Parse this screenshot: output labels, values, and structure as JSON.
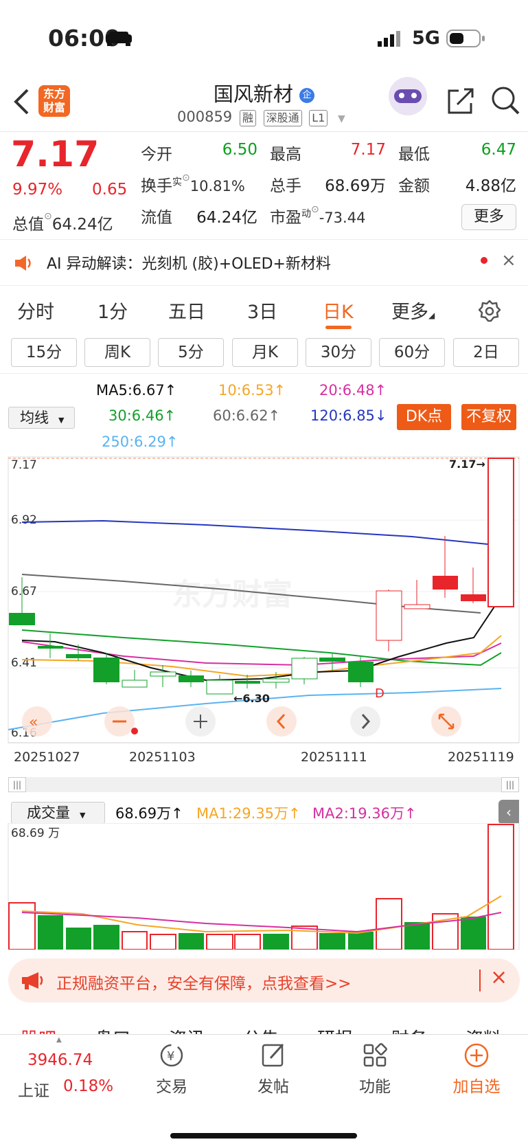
{
  "status_bar": {
    "time": "06:00",
    "network": "5G"
  },
  "header": {
    "logo_text_1": "东方",
    "logo_text_2": "财富",
    "stock_name": "国风新材",
    "stock_code": "000859",
    "tags": [
      "融",
      "深股通",
      "L1"
    ]
  },
  "quote": {
    "price": "7.17",
    "change_pct": "9.97%",
    "change_amt": "0.65",
    "open_label": "今开",
    "open": "6.50",
    "high_label": "最高",
    "high": "7.17",
    "low_label": "最低",
    "low": "6.47",
    "turnover_label": "换手",
    "turnover_sup": "实",
    "turnover": "10.81%",
    "volume_label": "总手",
    "volume": "68.69万",
    "amount_label": "金额",
    "amount": "4.88亿",
    "total_mv_label": "总值",
    "total_mv": "64.24亿",
    "float_mv_label": "流值",
    "float_mv": "64.24亿",
    "pe_label": "市盈",
    "pe_sup": "动",
    "pe": "-73.44",
    "more_button": "更多"
  },
  "ai_banner": {
    "text": "AI 异动解读：光刻机 (胶)+OLED+新材料"
  },
  "period_tabs": [
    "分时",
    "1分",
    "五日",
    "3日",
    "日K",
    "更多"
  ],
  "active_period": "日K",
  "sub_tabs": [
    "15分",
    "周K",
    "5分",
    "月K",
    "30分",
    "60分",
    "2日"
  ],
  "ma": {
    "selector": "均线",
    "ma5": "MA5:6.67↑",
    "ma10": "10:6.53↑",
    "ma20": "20:6.48↑",
    "ma30": "30:6.46↑",
    "ma60": "60:6.62↑",
    "ma120": "120:6.85↓",
    "ma250": "250:6.29↑",
    "dk_button": "DK点",
    "fq_button": "不复权",
    "colors": {
      "ma5": "#111111",
      "ma10": "#f5a623",
      "ma20": "#d62fa0",
      "ma30": "#12a02a",
      "ma60": "#666666",
      "ma120": "#2436c0",
      "ma250": "#5ab3f0"
    }
  },
  "kline": {
    "price_labels": [
      "7.17",
      "6.92",
      "6.67",
      "6.41",
      "6.16"
    ],
    "max_marker": "7.17→",
    "min_marker": "←6.30",
    "d_marker": "D",
    "watermark": "东方财富",
    "dates": [
      "20251027",
      "20251103",
      "20251111",
      "20251119"
    ]
  },
  "volume": {
    "selector": "成交量",
    "value": "68.69万↑",
    "ma1": "MA1:29.35万↑",
    "ma2": "MA2:19.36万↑",
    "axis_label": "68.69 万"
  },
  "promo": {
    "text": "正规融资平台，安全有保障，点我查看>>"
  },
  "info_tabs": [
    "股吧",
    "盘口",
    "资讯",
    "公告",
    "研报",
    "财务",
    "资料"
  ],
  "bottom_bar": {
    "index_value": "3946.74",
    "index_name": "上证",
    "index_change": "0.18%",
    "trade": "交易",
    "post": "发帖",
    "func": "功能",
    "add": "加自选"
  }
}
